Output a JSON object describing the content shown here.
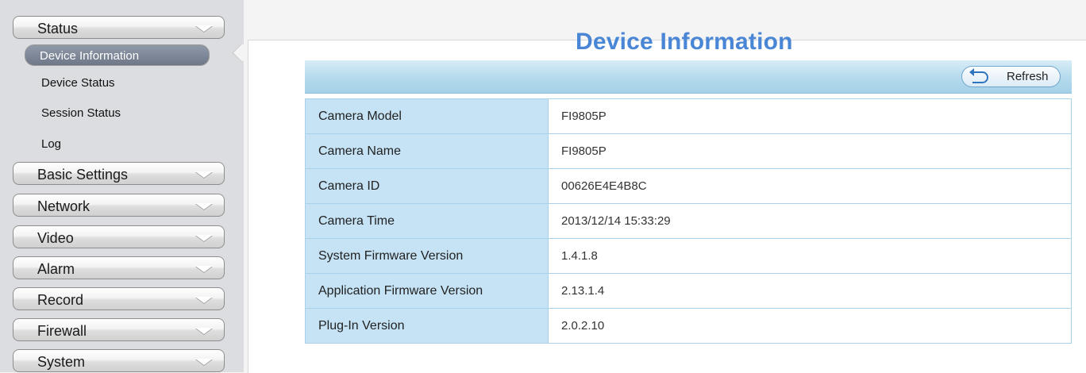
{
  "sidebar": {
    "menus": [
      {
        "label": "Status"
      },
      {
        "label": "Basic Settings"
      },
      {
        "label": "Network"
      },
      {
        "label": "Video"
      },
      {
        "label": "Alarm"
      },
      {
        "label": "Record"
      },
      {
        "label": "Firewall"
      },
      {
        "label": "System"
      }
    ],
    "status_submenu": {
      "active": "Device Information",
      "items": [
        "Device Status",
        "Session Status",
        "Log"
      ]
    }
  },
  "main": {
    "title": "Device Information",
    "refresh_label": "Refresh",
    "rows": [
      {
        "label": "Camera Model",
        "value": "FI9805P"
      },
      {
        "label": "Camera Name",
        "value": "FI9805P"
      },
      {
        "label": "Camera ID",
        "value": "00626E4E4B8C"
      },
      {
        "label": "Camera Time",
        "value": "2013/12/14 15:33:29"
      },
      {
        "label": "System Firmware Version",
        "value": "1.4.1.8"
      },
      {
        "label": "Application Firmware Version",
        "value": "2.13.1.4"
      },
      {
        "label": "Plug-In Version",
        "value": "2.0.2.10"
      }
    ]
  },
  "colors": {
    "title": "#4a86d6",
    "label_cell": "#c5e3f5",
    "toolbar": "#b6dbed",
    "active_submenu": "#7b8596"
  },
  "icons": {
    "menu_expand": "chevron-down-icon",
    "refresh": "refresh-icon"
  }
}
